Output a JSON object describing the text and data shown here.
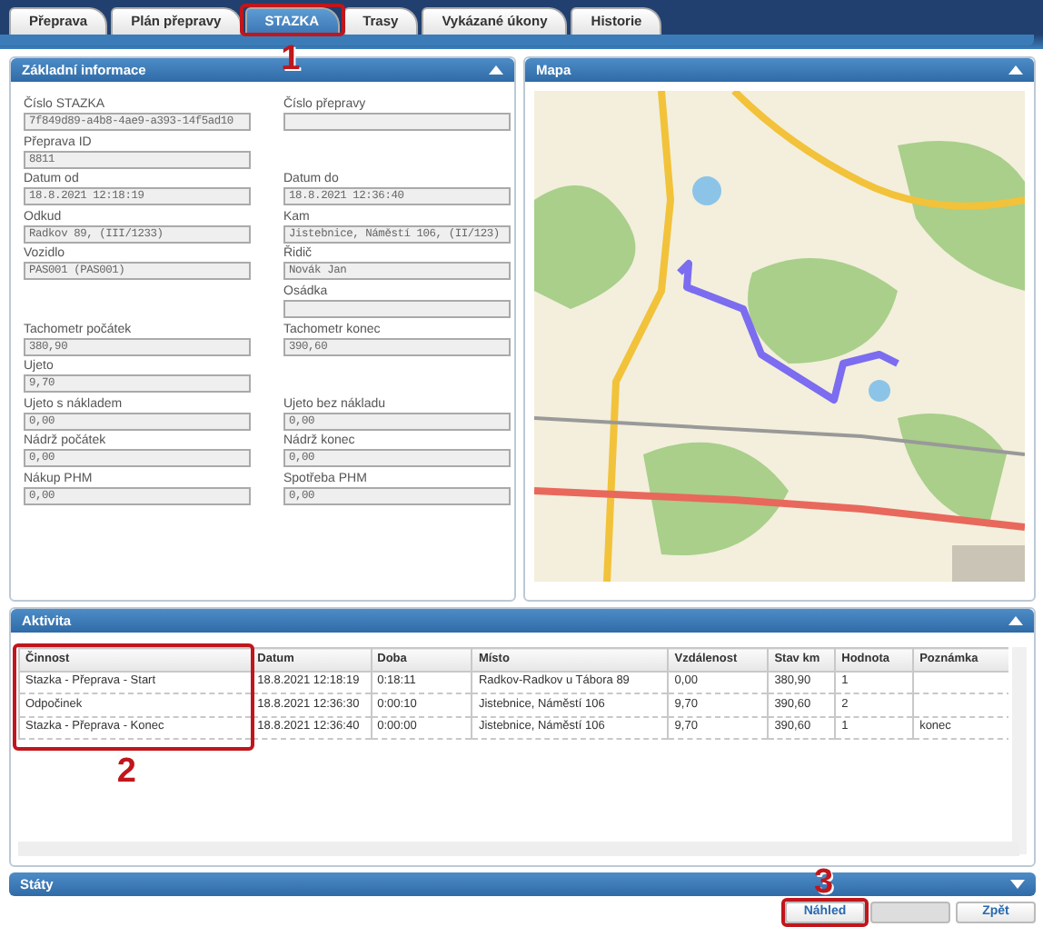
{
  "tabs": [
    {
      "label": "Přeprava",
      "selected": false
    },
    {
      "label": "Plán přepravy",
      "selected": false
    },
    {
      "label": "STAZKA",
      "selected": true,
      "annotation": "1"
    },
    {
      "label": "Trasy",
      "selected": false
    },
    {
      "label": "Vykázané úkony",
      "selected": false
    },
    {
      "label": "Historie",
      "selected": false
    }
  ],
  "basic_info": {
    "title": "Základní informace",
    "expanded": true,
    "rows": [
      {
        "left": {
          "label": "Číslo STAZKA",
          "value": "7f849d89-a4b8-4ae9-a393-14f5ad10"
        },
        "right": {
          "label": "Číslo přepravy"
        }
      },
      {
        "left": {
          "label": "Přeprava ID",
          "value": "8811"
        }
      },
      {
        "left": {
          "label": "Datum od",
          "value": "18.8.2021 12:18:19"
        },
        "right": {
          "label": "Datum do",
          "value": "18.8.2021 12:36:40"
        }
      },
      {
        "left": {
          "label": "Odkud",
          "value": "Radkov 89, (III/1233)"
        },
        "right": {
          "label": "Kam",
          "value": "Jistebnice, Náměstí 106, (II/123)"
        }
      },
      {
        "left": {
          "label": "Vozidlo",
          "value": "PAS001 (PAS001)"
        },
        "right": {
          "label": "Řidič",
          "value": "Novák Jan"
        }
      },
      {
        "right": {
          "label": "Osádka"
        }
      },
      {
        "left": {
          "label": "Tachometr počátek",
          "value": "380,90"
        },
        "right": {
          "label": "Tachometr konec",
          "value": "390,60"
        }
      },
      {
        "left": {
          "label": "Ujeto",
          "value": "9,70"
        }
      },
      {
        "left": {
          "label": "Ujeto s nákladem",
          "value": "0,00"
        },
        "right": {
          "label": "Ujeto bez nákladu",
          "value": "0,00"
        }
      },
      {
        "left": {
          "label": "Nádrž počátek",
          "value": "0,00"
        },
        "right": {
          "label": "Nádrž konec",
          "value": "0,00"
        }
      },
      {
        "left": {
          "label": "Nákup PHM",
          "value": "0,00"
        },
        "right": {
          "label": "Spotřeba PHM",
          "value": "0,00"
        }
      }
    ]
  },
  "map": {
    "title": "Mapa",
    "expanded": true,
    "kind": "picture"
  },
  "activity": {
    "title": "Aktivita",
    "expanded": true,
    "annotation": "2",
    "columns": [
      "Činnost",
      "Datum",
      "Doba",
      "Místo",
      "Vzdálenost",
      "Stav km",
      "Hodnota",
      "Poznámka"
    ],
    "rows": [
      [
        "Stazka - Přeprava - Start",
        "18.8.2021 12:18:19",
        "0:18:11",
        "Radkov-Radkov u Tábora 89",
        "0,00",
        "380,90",
        "1",
        ""
      ],
      [
        "Odpočinek",
        "18.8.2021 12:36:30",
        "0:00:10",
        "Jistebnice, Náměstí 106",
        "9,70",
        "390,60",
        "2",
        ""
      ],
      [
        "Stazka - Přeprava - Konec",
        "18.8.2021 12:36:40",
        "0:00:00",
        "Jistebnice, Náměstí 106",
        "9,70",
        "390,60",
        "1",
        "konec"
      ]
    ]
  },
  "states_panel": {
    "title": "Státy",
    "expanded": false
  },
  "buttons": [
    {
      "label": "Náhled",
      "disabled": false,
      "annotation": "3"
    },
    {
      "disabled": true
    },
    {
      "label": "Zpět",
      "disabled": false
    }
  ]
}
